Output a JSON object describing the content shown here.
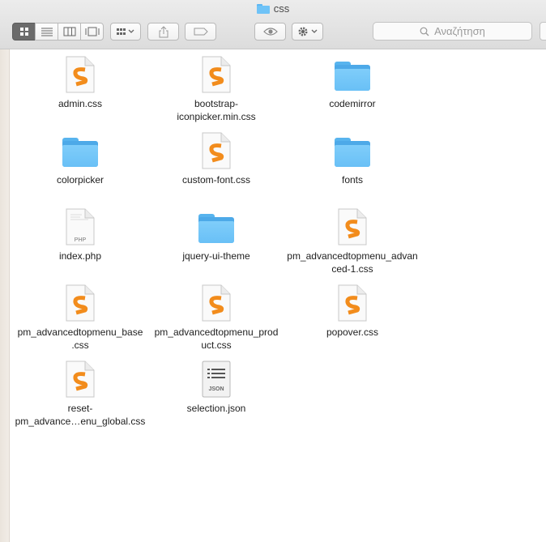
{
  "window": {
    "title": "css"
  },
  "toolbar": {
    "view_buttons": [
      "icon-view",
      "list-view",
      "column-view",
      "gallery-view"
    ],
    "arrange_icon": "arrange-grid-icon",
    "share_icon": "share-icon",
    "tag_icon": "tag-icon",
    "quicklook_icon": "eye-icon",
    "action_icon": "gear-icon",
    "search_placeholder": "Αναζήτηση"
  },
  "colors": {
    "folder": "#6fc3f7",
    "sublime_orange": "#f28c1c",
    "selected_segment": "#6b6b6b"
  },
  "files": [
    {
      "name": "admin.css",
      "kind": "css"
    },
    {
      "name": "bootstrap-iconpicker.min.css",
      "kind": "css"
    },
    {
      "name": "codemirror",
      "kind": "folder"
    },
    {
      "name": "colorpicker",
      "kind": "folder"
    },
    {
      "name": "custom-font.css",
      "kind": "css"
    },
    {
      "name": "fonts",
      "kind": "folder"
    },
    {
      "name": "index.php",
      "kind": "php"
    },
    {
      "name": "jquery-ui-theme",
      "kind": "folder"
    },
    {
      "name": "pm_advancedtopmenu_advanced-1.css",
      "kind": "css"
    },
    {
      "name": "pm_advancedtopmenu_base.css",
      "kind": "css"
    },
    {
      "name": "pm_advancedtopmenu_product.css",
      "kind": "css"
    },
    {
      "name": "popover.css",
      "kind": "css"
    },
    {
      "name": "reset-pm_advance…enu_global.css",
      "kind": "css"
    },
    {
      "name": "selection.json",
      "kind": "json"
    }
  ],
  "file_labels": {
    "0": "admin.css",
    "1a": "bootstrap-",
    "1b": "iconpicker.min.css",
    "2": "codemirror",
    "3": "colorpicker",
    "4": "custom-font.css",
    "5": "fonts",
    "6": "index.php",
    "7": "jquery-ui-theme",
    "8a": "pm_advancedtopmenu_advan",
    "8b": "ced-1.css",
    "9a": "pm_advancedtopmenu_base",
    "9b": ".css",
    "10a": "pm_advancedtopmenu_prod",
    "10b": "uct.css",
    "11": "popover.css",
    "12a": "reset-",
    "12b": "pm_advance…enu_global.css",
    "13": "selection.json"
  },
  "icon_text": {
    "php": "PHP",
    "json": "JSON"
  }
}
